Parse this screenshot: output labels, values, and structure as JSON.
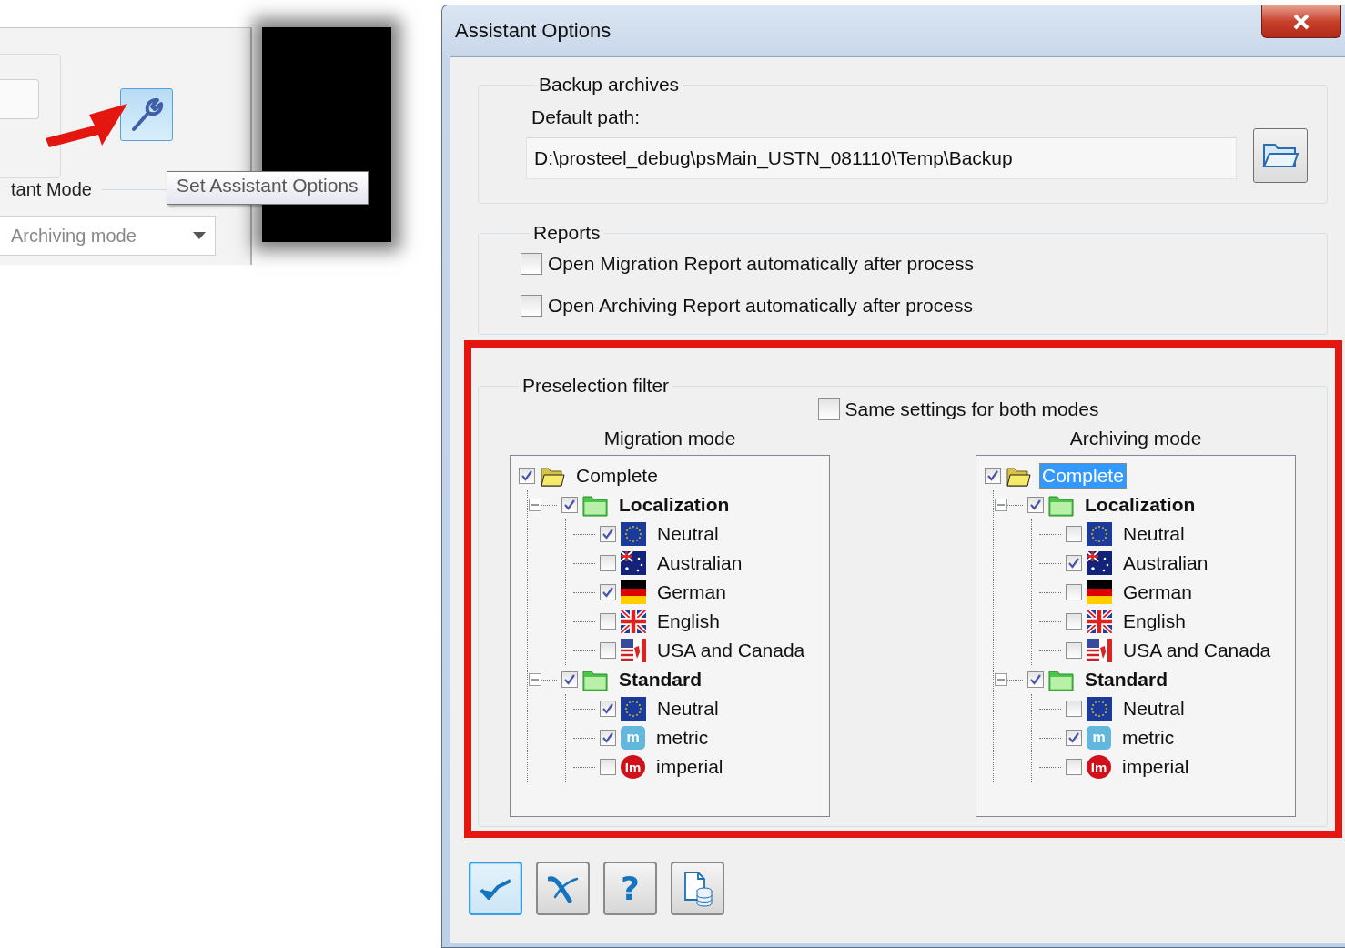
{
  "inset": {
    "mode_label": "tant Mode",
    "dropdown": "Archiving mode",
    "tooltip": "Set Assistant Options"
  },
  "dialog": {
    "title": "Assistant Options",
    "backup": {
      "legend": "Backup archives",
      "path_label": "Default path:",
      "path": "D:\\prosteel_debug\\psMain_USTN_081110\\Temp\\Backup"
    },
    "reports": {
      "legend": "Reports",
      "options": [
        {
          "label": "Open Migration Report automatically after process",
          "checked": false
        },
        {
          "label": "Open Archiving Report automatically after process",
          "checked": false
        }
      ]
    },
    "preselection": {
      "legend": "Preselection filter",
      "same_settings": {
        "label": "Same settings for both modes",
        "checked": false
      },
      "trees": [
        {
          "title": "Migration mode",
          "root": {
            "label": "Complete",
            "kind": "root",
            "checked": true,
            "selected": false,
            "children": [
              {
                "label": "Localization",
                "kind": "group",
                "checked": true,
                "selected": false,
                "expanded": true,
                "children": [
                  {
                    "label": "Neutral",
                    "kind": "eu",
                    "checked": true,
                    "selected": false
                  },
                  {
                    "label": "Australian",
                    "kind": "au",
                    "checked": false,
                    "selected": false
                  },
                  {
                    "label": "German",
                    "kind": "de",
                    "checked": true,
                    "selected": false
                  },
                  {
                    "label": "English",
                    "kind": "uk",
                    "checked": false,
                    "selected": false
                  },
                  {
                    "label": "USA and Canada",
                    "kind": "usca",
                    "checked": false,
                    "selected": false
                  }
                ]
              },
              {
                "label": "Standard",
                "kind": "group",
                "checked": true,
                "selected": false,
                "expanded": true,
                "children": [
                  {
                    "label": "Neutral",
                    "kind": "eu",
                    "checked": true,
                    "selected": false
                  },
                  {
                    "label": "metric",
                    "kind": "metric",
                    "badge": "m",
                    "checked": true,
                    "selected": false
                  },
                  {
                    "label": "imperial",
                    "kind": "imperial",
                    "badge": "Im",
                    "checked": false,
                    "selected": false
                  }
                ]
              }
            ]
          }
        },
        {
          "title": "Archiving mode",
          "root": {
            "label": "Complete",
            "kind": "root",
            "checked": true,
            "selected": true,
            "children": [
              {
                "label": "Localization",
                "kind": "group",
                "checked": true,
                "selected": false,
                "expanded": true,
                "children": [
                  {
                    "label": "Neutral",
                    "kind": "eu",
                    "checked": false,
                    "selected": false
                  },
                  {
                    "label": "Australian",
                    "kind": "au",
                    "checked": true,
                    "selected": false
                  },
                  {
                    "label": "German",
                    "kind": "de",
                    "checked": false,
                    "selected": false
                  },
                  {
                    "label": "English",
                    "kind": "uk",
                    "checked": false,
                    "selected": false
                  },
                  {
                    "label": "USA and Canada",
                    "kind": "usca",
                    "checked": false,
                    "selected": false
                  }
                ]
              },
              {
                "label": "Standard",
                "kind": "group",
                "checked": true,
                "selected": false,
                "expanded": true,
                "children": [
                  {
                    "label": "Neutral",
                    "kind": "eu",
                    "checked": false,
                    "selected": false
                  },
                  {
                    "label": "metric",
                    "kind": "metric",
                    "badge": "m",
                    "checked": true,
                    "selected": false
                  },
                  {
                    "label": "imperial",
                    "kind": "imperial",
                    "badge": "Im",
                    "checked": false,
                    "selected": false
                  }
                ]
              }
            ]
          }
        }
      ]
    },
    "buttons": [
      {
        "kind": "ok",
        "focused": true
      },
      {
        "kind": "cancel",
        "focused": false
      },
      {
        "kind": "help",
        "label": "?",
        "focused": false
      },
      {
        "kind": "report",
        "focused": false
      }
    ]
  }
}
